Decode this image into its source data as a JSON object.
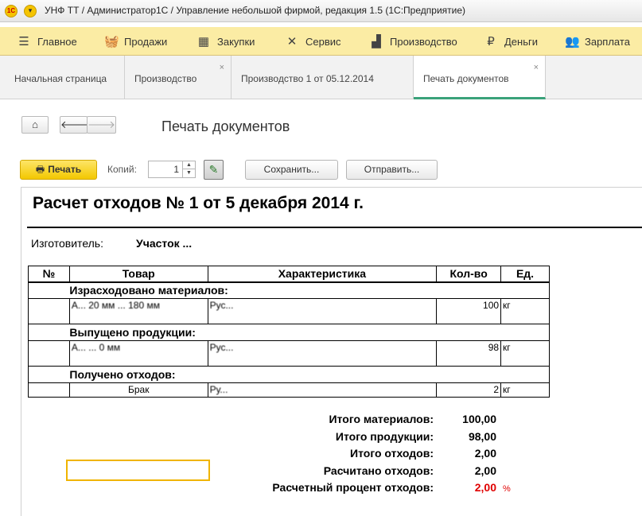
{
  "window": {
    "title": "УНФ ТТ / Администратор1С / Управление небольшой фирмой, редакция 1.5  (1С:Предприятие)"
  },
  "main_menu": [
    {
      "label": "Главное",
      "icon": "hamburger-icon"
    },
    {
      "label": "Продажи",
      "icon": "basket-icon"
    },
    {
      "label": "Закупки",
      "icon": "grid-icon"
    },
    {
      "label": "Сервис",
      "icon": "tools-icon"
    },
    {
      "label": "Производство",
      "icon": "factory-icon"
    },
    {
      "label": "Деньги",
      "icon": "ruble-icon"
    },
    {
      "label": "Зарплата",
      "icon": "people-icon"
    }
  ],
  "tabs": [
    {
      "label": "Начальная страница",
      "closable": false
    },
    {
      "label": "Производство",
      "closable": true
    },
    {
      "label": "Производство 1 от 05.12.2014",
      "closable": false
    },
    {
      "label": "Печать документов",
      "closable": true,
      "active": true
    }
  ],
  "page": {
    "title": "Печать документов"
  },
  "toolbar": {
    "print_label": "Печать",
    "copies_label": "Копий:",
    "copies_value": "1",
    "save_label": "Сохранить...",
    "send_label": "Отправить..."
  },
  "document": {
    "title": "Расчет отходов № 1 от 5 декабря 2014 г.",
    "manufacturer_label": "Изготовитель:",
    "manufacturer_value": "Участок ...",
    "columns": [
      "№",
      "Товар",
      "Характеристика",
      "Кол-во",
      "Ед."
    ],
    "sections": [
      {
        "title": "Израсходовано материалов:",
        "rows": [
          {
            "num": "",
            "product": "А... 20 мм ... 180 мм",
            "characteristic": "Рус...",
            "qty": "100",
            "unit": "кг"
          }
        ]
      },
      {
        "title": "Выпущено продукции:",
        "rows": [
          {
            "num": "",
            "product": "А... ... 0 мм",
            "characteristic": "Рус...",
            "qty": "98",
            "unit": "кг"
          }
        ]
      },
      {
        "title": "Получено отходов:",
        "rows": [
          {
            "num": "",
            "product": "Брак",
            "characteristic": "Ру...",
            "qty": "2",
            "unit": "кг"
          }
        ]
      }
    ],
    "totals": [
      {
        "label": "Итого материалов:",
        "value": "100,00"
      },
      {
        "label": "Итого продукции:",
        "value": "98,00"
      },
      {
        "label": "Итого отходов:",
        "value": "2,00"
      },
      {
        "label": "Расчитано отходов:",
        "value": "2,00"
      },
      {
        "label": "Расчетный процент отходов:",
        "value": "2,00",
        "unit": "%",
        "highlight": true
      }
    ]
  },
  "colors": {
    "menu_bg": "#fbeca4",
    "accent_tab": "#3aa27a",
    "print_button": "#f3c800",
    "highlight_red": "#e00000"
  }
}
